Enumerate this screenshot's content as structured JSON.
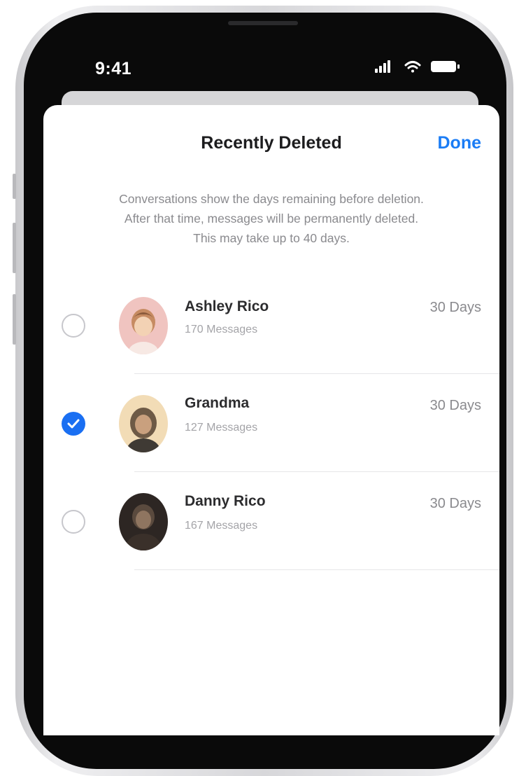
{
  "status_bar": {
    "time": "9:41",
    "icons": [
      "cellular-signal-icon",
      "wifi-icon",
      "battery-icon"
    ]
  },
  "sheet": {
    "title": "Recently Deleted",
    "done_label": "Done",
    "description_lines": [
      "Conversations show the days remaining before deletion.",
      "After that time, messages will be permanently deleted.",
      "This may take up to 40 days."
    ]
  },
  "conversations": [
    {
      "name": "Ashley Rico",
      "count": "170 Messages",
      "days": "30 Days",
      "selected": false
    },
    {
      "name": "Grandma",
      "count": "127 Messages",
      "days": "30 Days",
      "selected": true
    },
    {
      "name": "Danny Rico",
      "count": "167 Messages",
      "days": "30 Days",
      "selected": false
    }
  ],
  "colors": {
    "accent": "#1a7cf5",
    "checkbox_selected": "#1a6ff2",
    "secondary_text": "#8a8a8e"
  }
}
